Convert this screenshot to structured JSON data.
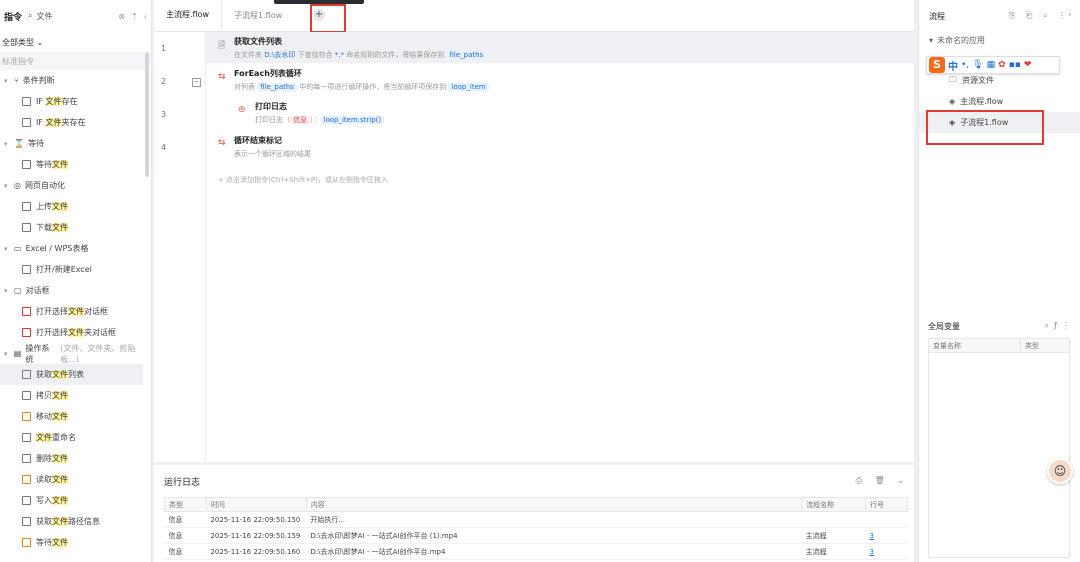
{
  "left": {
    "title": "指令",
    "search_value": "文件",
    "type_filter": "全部类型",
    "sub_header": "标准指令",
    "categories": [
      {
        "label": "条件判断",
        "items": [
          {
            "pre": "IF ",
            "hl": "文件",
            "post": "存在"
          },
          {
            "pre": "IF ",
            "hl": "文件",
            "post": "夹存在"
          }
        ]
      },
      {
        "label": "等待",
        "items": [
          {
            "pre": "等待",
            "hl": "文件",
            "post": ""
          }
        ]
      },
      {
        "label": "网页自动化",
        "items": [
          {
            "pre": "上传",
            "hl": "文件",
            "post": ""
          },
          {
            "pre": "下载",
            "hl": "文件",
            "post": ""
          }
        ]
      },
      {
        "label": "Excel / WPS表格",
        "items": [
          {
            "pre": "打开/新建Excel",
            "hl": "",
            "post": ""
          }
        ]
      },
      {
        "label": "对话框",
        "items": [
          {
            "pre": "打开选择",
            "hl": "文件",
            "post": "对话框"
          },
          {
            "pre": "打开选择",
            "hl": "文件",
            "post": "夹对话框"
          }
        ]
      },
      {
        "label": "操作系统",
        "sub": "(文件、文件夹、剪贴板...)",
        "items": [
          {
            "pre": "获取",
            "hl": "文件",
            "post": "列表"
          },
          {
            "pre": "拷贝",
            "hl": "文件",
            "post": ""
          },
          {
            "pre": "移动",
            "hl": "文件",
            "post": ""
          },
          {
            "pre": "",
            "hl": "文件",
            "post": "重命名"
          },
          {
            "pre": "删除",
            "hl": "文件",
            "post": ""
          },
          {
            "pre": "读取",
            "hl": "文件",
            "post": ""
          },
          {
            "pre": "写入",
            "hl": "文件",
            "post": ""
          },
          {
            "pre": "获取",
            "hl": "文件",
            "post": "路径信息"
          },
          {
            "pre": "等待",
            "hl": "文件",
            "post": ""
          }
        ]
      }
    ]
  },
  "tabs": [
    {
      "label": "主流程.flow"
    },
    {
      "label": "子流程1.flow"
    }
  ],
  "add_tab": "+",
  "editor": {
    "lines": [
      "1",
      "2",
      "3",
      "4"
    ],
    "step1": {
      "title": "获取文件列表",
      "d1": "在文件夹 ",
      "path": "D:\\去水印",
      "d2": " 下查找符合 ",
      "pattern": "*.*",
      "d3": " 命名规则的文件，将结果保存到 ",
      "var": "file_paths"
    },
    "step2": {
      "title": "ForEach列表循环",
      "d1": "对列表 ",
      "list": "file_paths",
      "d2": " 中的每一项进行循环操作，将当前循环项保存到 ",
      "var": "loop_item"
    },
    "step3": {
      "title": "打印日志",
      "d1": "打印日志（",
      "level": "信息",
      "d2": "）：",
      "expr": "loop_item.strip()"
    },
    "step4": {
      "title": "循环结束标记",
      "desc": "表示一个循环区域的结尾"
    },
    "add_hint": "+ 点击添加指令(Ctrl+Shift+P)，或从左侧指令区拖入"
  },
  "log": {
    "title": "运行日志",
    "columns": [
      "类型",
      "时间",
      "内容",
      "流程名称",
      "行号"
    ],
    "rows": [
      [
        "信息",
        "2025-11-16 22:09:50.150",
        "开始执行...",
        "",
        ""
      ],
      [
        "信息",
        "2025-11-16 22:09:50.159",
        "D:\\去水印\\即梦AI - 一站式AI创作平台 (1).mp4",
        "主流程",
        "3"
      ],
      [
        "信息",
        "2025-11-16 22:09:50.160",
        "D:\\去水印\\即梦AI - 一站式AI创作平台.mp4",
        "主流程",
        "3"
      ]
    ]
  },
  "right": {
    "title": "流程",
    "app_name": "未命名的应用",
    "flows": [
      {
        "label": "资源文件"
      },
      {
        "label": "主流程.flow"
      },
      {
        "label": "子流程1.flow"
      }
    ],
    "ime": {
      "logo": "S",
      "lang": "中"
    },
    "globals": {
      "title": "全局变量",
      "columns": [
        "变量名称",
        "类型"
      ]
    }
  },
  "colors": {
    "accent": "#1e6fd9",
    "highlight": "#fff3a0",
    "annotation": "#e53935"
  }
}
